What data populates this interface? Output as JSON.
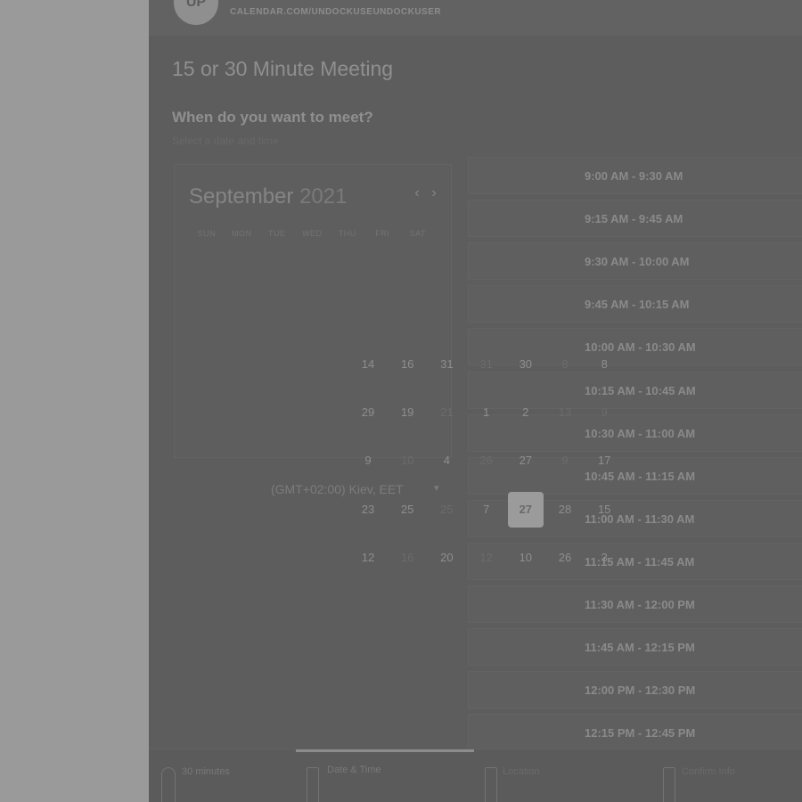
{
  "header": {
    "avatar_initials": "UP",
    "calendar_url": "CALENDAR.COM/UNDOCKUSEUNDOCKUSER"
  },
  "meeting": {
    "title": "15 or 30 Minute Meeting",
    "question": "When do you want to meet?",
    "subtitle": "Select a date and time"
  },
  "calendar": {
    "month": "September",
    "year": "2021",
    "prev_icon": "chevron-left-icon",
    "next_icon": "chevron-right-icon",
    "prev_glyph": "‹",
    "next_glyph": "›",
    "weekdays": [
      "SUN",
      "MON",
      "TUE",
      "WED",
      "THU",
      "FRI",
      "SAT"
    ],
    "days": [
      {
        "label": "14",
        "faded": false
      },
      {
        "label": "16",
        "faded": false
      },
      {
        "label": "31",
        "faded": false
      },
      {
        "label": "31",
        "faded": true
      },
      {
        "label": "30",
        "faded": false
      },
      {
        "label": "8",
        "faded": true
      },
      {
        "label": "8",
        "faded": false
      },
      {
        "label": "29",
        "faded": false
      },
      {
        "label": "19",
        "faded": false
      },
      {
        "label": "21",
        "faded": true
      },
      {
        "label": "1",
        "faded": false
      },
      {
        "label": "2",
        "faded": false
      },
      {
        "label": "13",
        "faded": true
      },
      {
        "label": "9",
        "faded": true
      },
      {
        "label": "9",
        "faded": false
      },
      {
        "label": "10",
        "faded": true
      },
      {
        "label": "4",
        "faded": false
      },
      {
        "label": "26",
        "faded": true
      },
      {
        "label": "27",
        "faded": false
      },
      {
        "label": "9",
        "faded": true
      },
      {
        "label": "17",
        "faded": false
      },
      {
        "label": "23",
        "faded": false
      },
      {
        "label": "25",
        "faded": false
      },
      {
        "label": "25",
        "faded": true
      },
      {
        "label": "7",
        "faded": false
      },
      {
        "label": "27",
        "faded": false,
        "selected": true
      },
      {
        "label": "28",
        "faded": false
      },
      {
        "label": "15",
        "faded": false
      },
      {
        "label": "12",
        "faded": false
      },
      {
        "label": "16",
        "faded": true
      },
      {
        "label": "20",
        "faded": false
      },
      {
        "label": "12",
        "faded": true
      },
      {
        "label": "10",
        "faded": false
      },
      {
        "label": "26",
        "faded": false
      },
      {
        "label": "3",
        "faded": false
      }
    ],
    "selected_day": "27"
  },
  "timezone": {
    "label": "(GMT+02:00) Kiev, EET",
    "caret": "▾"
  },
  "time_slots": [
    "9:00 AM - 9:30 AM",
    "9:15 AM - 9:45 AM",
    "9:30 AM - 10:00 AM",
    "9:45 AM - 10:15 AM",
    "10:00 AM - 10:30 AM",
    "10:15 AM - 10:45 AM",
    "10:30 AM - 11:00 AM",
    "10:45 AM - 11:15 AM",
    "11:00 AM - 11:30 AM",
    "11:15 AM - 11:45 AM",
    "11:30 AM - 12:00 PM",
    "11:45 AM - 12:15 PM",
    "12:00 PM - 12:30 PM",
    "12:15 PM - 12:45 PM"
  ],
  "steps": {
    "duration": "30 minutes",
    "date_time": "Date & Time",
    "location": "Location",
    "confirm": "Confirm Info"
  }
}
